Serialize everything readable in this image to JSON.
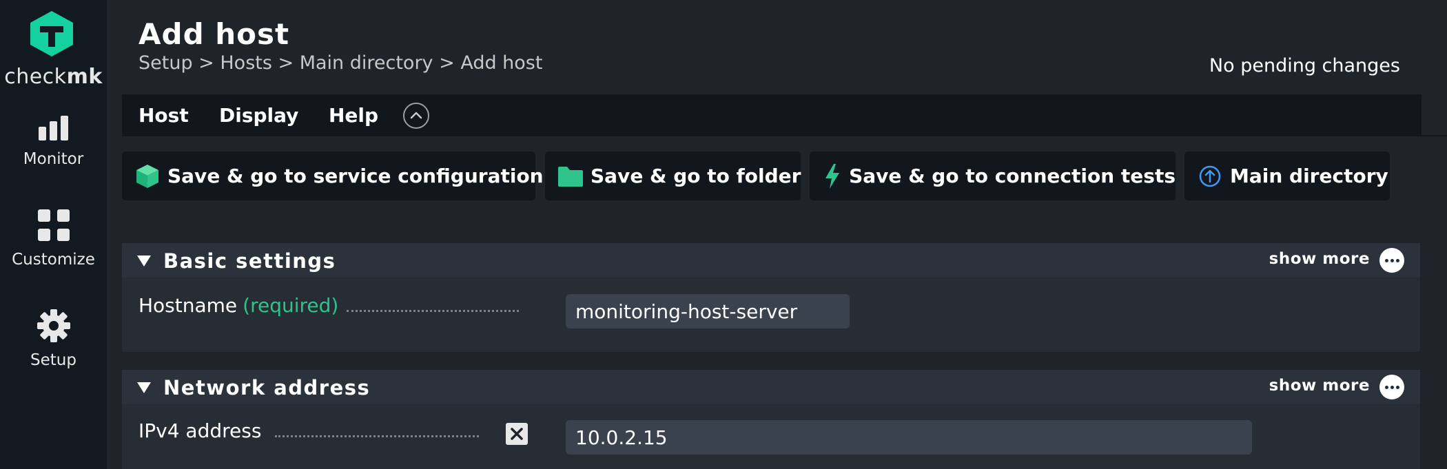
{
  "app": {
    "logo_text_light": "check",
    "logo_text_bold": "mk",
    "brand_color": "#15d1a0"
  },
  "sidebar": {
    "items": [
      {
        "label": "Monitor",
        "icon": "bar-chart-icon"
      },
      {
        "label": "Customize",
        "icon": "grid-icon"
      },
      {
        "label": "Setup",
        "icon": "gear-icon"
      }
    ]
  },
  "header": {
    "title": "Add host",
    "breadcrumb": "Setup > Hosts > Main directory > Add host",
    "pending_changes": "No pending changes"
  },
  "menu": {
    "items": [
      "Host",
      "Display",
      "Help"
    ]
  },
  "actions": [
    {
      "label": "Save & go to service configuration",
      "icon": "cube-icon",
      "color": "#2fc48b"
    },
    {
      "label": "Save & go to folder",
      "icon": "folder-icon",
      "color": "#2fc48b"
    },
    {
      "label": "Save & go to connection tests",
      "icon": "lightning-icon",
      "color": "#2fc48b"
    },
    {
      "label": "Main directory",
      "icon": "arrow-up-circle-icon",
      "color": "#3f9bf2"
    }
  ],
  "sections": {
    "basic": {
      "title": "Basic settings",
      "show_more": "show more",
      "hostname_label": "Hostname",
      "hostname_required": "(required)",
      "hostname_value": "monitoring-host-server"
    },
    "network": {
      "title": "Network address",
      "show_more": "show more",
      "ipv4_label": "IPv4 address",
      "ipv4_value": "10.0.2.15"
    }
  }
}
